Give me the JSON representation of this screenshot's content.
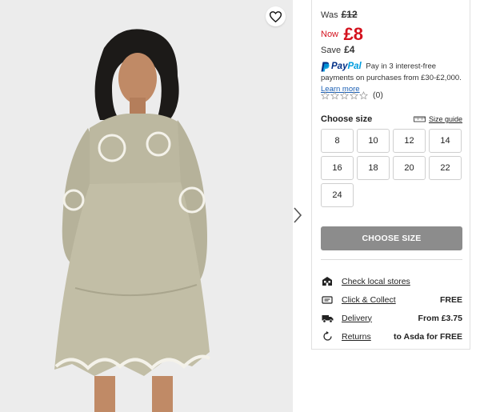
{
  "price": {
    "was_label": "Was",
    "was_value": "£12",
    "now_label": "Now",
    "now_value": "£8",
    "save_label": "Save",
    "save_value": "£4",
    "accent_color": "#d4121e"
  },
  "paypal": {
    "logo_part1": "Pay",
    "logo_part2": "Pal",
    "text": "Pay in 3 interest-free payments on purchases from £30-£2,000.",
    "link": "Learn more"
  },
  "rating": {
    "count": "(0)",
    "stars": 5,
    "filled": 0
  },
  "sizes": {
    "title": "Choose size",
    "guide_label": "Size guide",
    "options": [
      "8",
      "10",
      "12",
      "14",
      "16",
      "18",
      "20",
      "22",
      "24"
    ]
  },
  "cta": {
    "label": "CHOOSE SIZE",
    "color": "#8c8c8c"
  },
  "delivery": [
    {
      "icon": "store-icon",
      "label": "Check local stores",
      "value": ""
    },
    {
      "icon": "click-collect-icon",
      "label": "Click & Collect",
      "value": "FREE"
    },
    {
      "icon": "truck-icon",
      "label": "Delivery",
      "value": "From £3.75"
    },
    {
      "icon": "returns-icon",
      "label": "Returns",
      "value": "to Asda for FREE"
    }
  ],
  "gallery": {
    "favorite_icon": "heart-icon",
    "next_icon": "chevron-right-icon"
  }
}
